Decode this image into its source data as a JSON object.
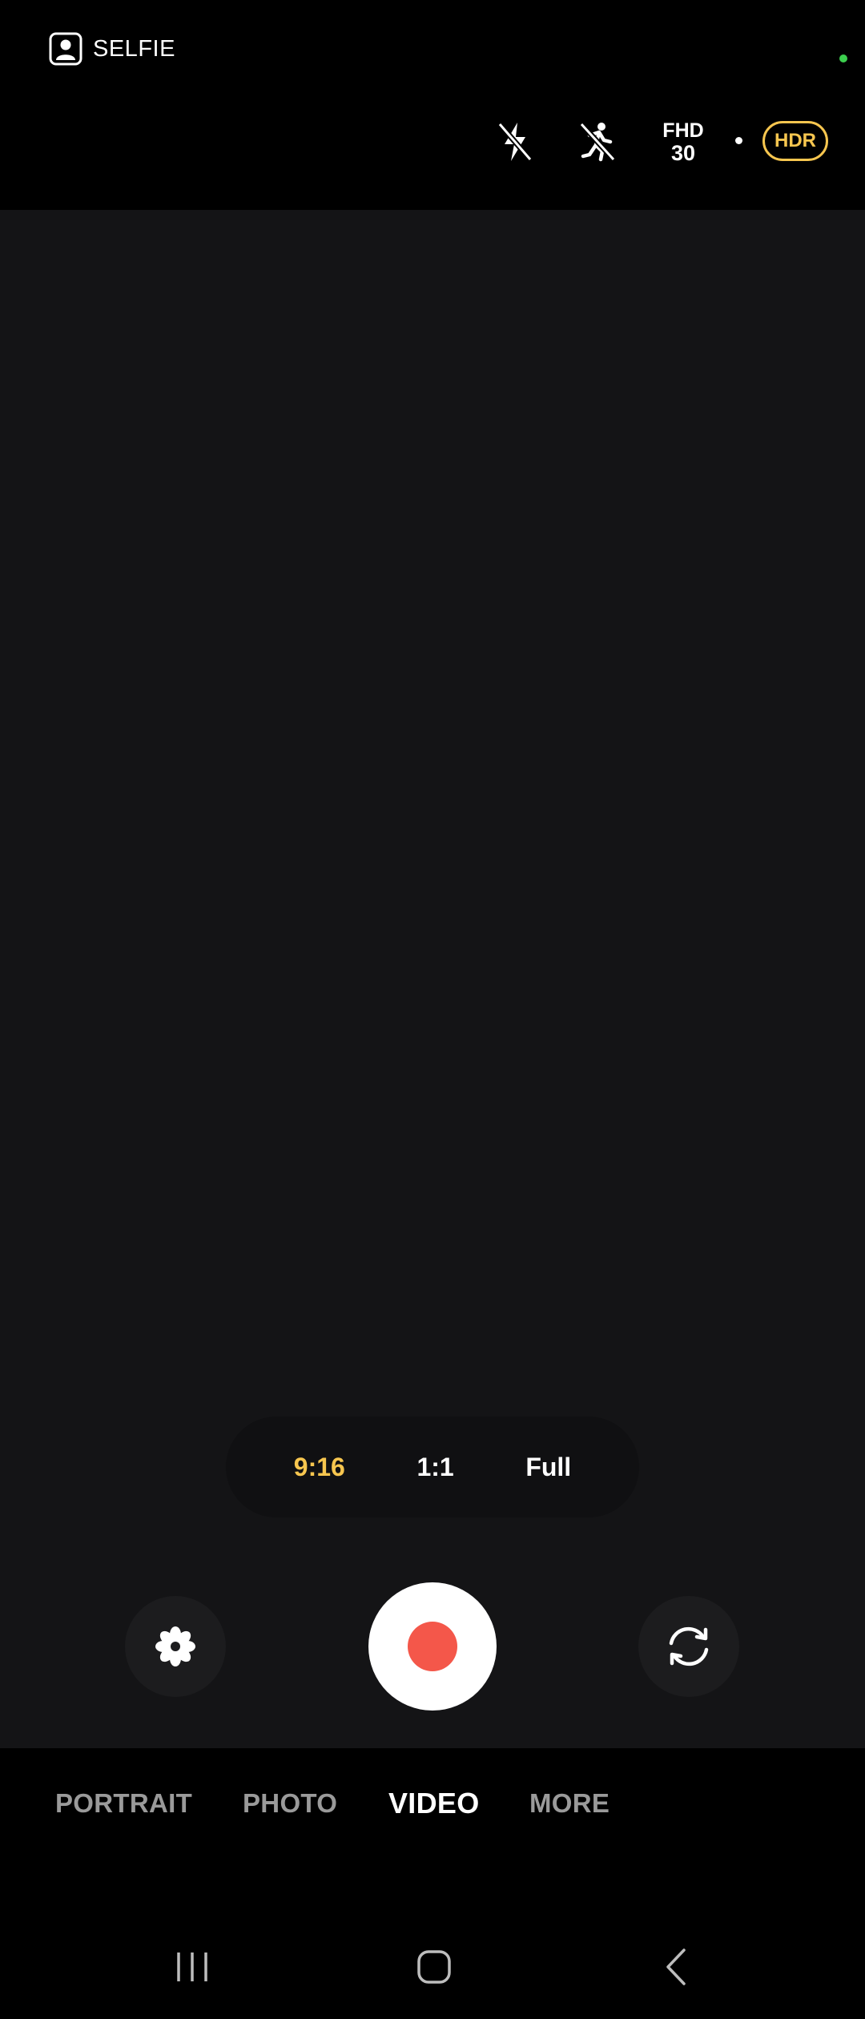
{
  "top_bar": {
    "selfie_label": "SELFIE",
    "selfie_icon": "selfie-portrait-icon",
    "flash_icon": "flash-off-icon",
    "motion_icon": "motion-off-icon",
    "resolution_top": "FHD",
    "resolution_bottom": "30",
    "hdr_label": "HDR",
    "status_dot_color": "#3ccf4e"
  },
  "ratio_options": {
    "opt1": "9:16",
    "opt2": "1:1",
    "opt3": "Full",
    "active": "9:16"
  },
  "controls": {
    "effects_icon": "flower-effects-icon",
    "record_icon": "record-icon",
    "flip_icon": "switch-camera-icon",
    "record_color": "#f4574a"
  },
  "modes": {
    "portrait": "PORTRAIT",
    "photo": "PHOTO",
    "video": "VIDEO",
    "more": "MORE",
    "active": "VIDEO"
  },
  "colors": {
    "accent": "#f7c64f",
    "viewfinder_bg": "#141416"
  },
  "nav": {
    "recents_icon": "recents-icon",
    "home_icon": "home-icon",
    "back_icon": "back-icon"
  }
}
